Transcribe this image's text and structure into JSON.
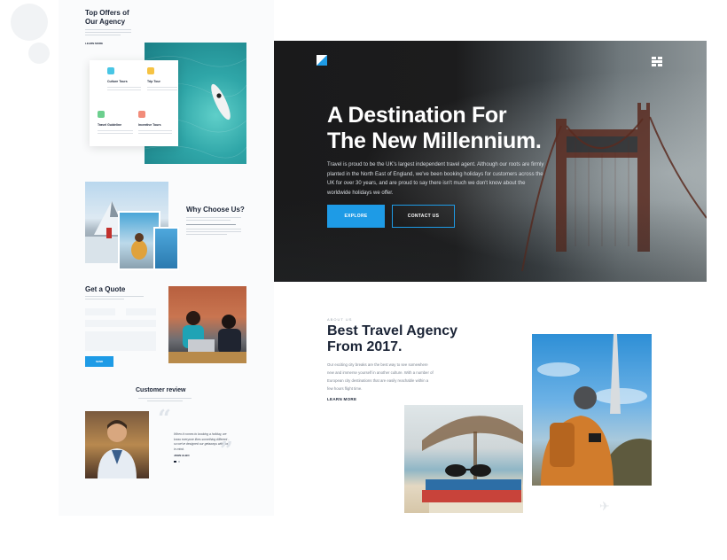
{
  "offers": {
    "title_line1": "Top Offers of",
    "title_line2": "Our Agency",
    "link": "LEARN MORE",
    "cards": [
      {
        "title": "Culture Tours",
        "icon": "globe-icon",
        "color": "#49c6e5"
      },
      {
        "title": "Trip Tour",
        "icon": "map-icon",
        "color": "#f6c343"
      },
      {
        "title": "Travel Guideline",
        "icon": "compass-icon",
        "color": "#6ccf8e"
      },
      {
        "title": "Incentive Tours",
        "icon": "gift-icon",
        "color": "#f28c7a"
      }
    ]
  },
  "why": {
    "title": "Why Choose Us?"
  },
  "quote": {
    "title": "Get a Quote",
    "button": "SEND"
  },
  "review": {
    "title": "Customer review",
    "quote": "When it comes to booking a holiday, we know everyone likes something different - so we've designed our getaways with you in mind.",
    "author": "JOHN ALBO"
  },
  "hero": {
    "title_line1": "A Destination For",
    "title_line2": "The New Millennium.",
    "text": "Travel is proud to be the UK's largest independent travel agent. Although our roots are firmly planted in the North East of England, we've been booking holidays for customers across the UK for over 30 years, and are proud to say there isn't much we don't know about the worldwide holidays we offer.",
    "explore": "EXPLORE",
    "contact": "CONTACT US"
  },
  "about": {
    "kicker": "ABOUT US",
    "title_line1": "Best Travel Agency",
    "title_line2": "From 2017.",
    "text": "Our exciting city breaks are the best way to see somewhere new and immerse yourself in another culture. With a number of European city destinations that are easily reachable within a few hours flight time.",
    "link": "LEARN MORE"
  },
  "colors": {
    "accent": "#1e9be6",
    "navy": "#1b2436"
  }
}
